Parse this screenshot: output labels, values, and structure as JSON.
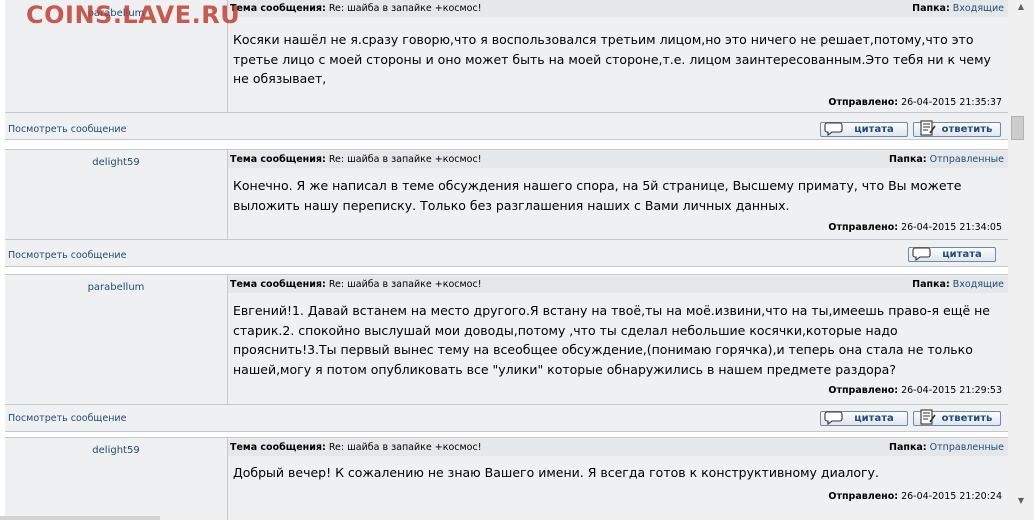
{
  "watermark": "COINS.LAVE.RU",
  "labels": {
    "subject_key": "Тема сообщения:",
    "folder_key": "Папка:",
    "sent_key": "Отправлено:",
    "view_link": "Посмотреть сообщение",
    "quote_button": "цитата",
    "reply_button": "ответить"
  },
  "messages": [
    {
      "author": "parabellum",
      "subject": "Re: шайба в запайке +космос!",
      "folder": "Входящие",
      "body": "Косяки нашёл не я.сразу говорю,что я воспользовался третьим лицом,но это ничего не решает,потому,что это третье лицо с моей стороны и оно может быть на моей стороне,т.е. лицом заинтересованным.Это тебя ни к чему не обязывает,",
      "sent": "26-04-2015 21:35:37"
    },
    {
      "author": "delight59",
      "subject": "Re: шайба в запайке +космос!",
      "folder": "Отправленные",
      "body": "Конечно. Я же написал в теме обсуждения нашего спора, на 5й странице, Высшему примату, что Вы можете выложить нашу переписку. Только без разглашения наших с Вами личных данных.",
      "sent": "26-04-2015 21:34:05"
    },
    {
      "author": "parabellum",
      "subject": "Re: шайба в запайке +космос!",
      "folder": "Входящие",
      "body": "Евгений!1. Давай встанем на место другого.Я встану на твоё,ты на моё.извини,что на ты,имеешь право-я ещё не старик.2. спокойно выслушай мои доводы,потому ,что ты сделал небольшие косячки,которые надо прояснить!3.Ты первый вынес тему на всеобщее обсуждение,(понимаю горячка),и теперь она стала не только нашей,могу я потом опубликовать все \"улики\" которые обнаружились в нашем предмете раздора?",
      "sent": "26-04-2015 21:29:53"
    },
    {
      "author": "delight59",
      "subject": "Re: шайба в запайке +космос!",
      "folder": "Отправленные",
      "body": "Добрый вечер! К сожалению не знаю Вашего имени. Я всегда готов к конструктивному диалогу.",
      "sent": "26-04-2015 21:20:24"
    }
  ]
}
